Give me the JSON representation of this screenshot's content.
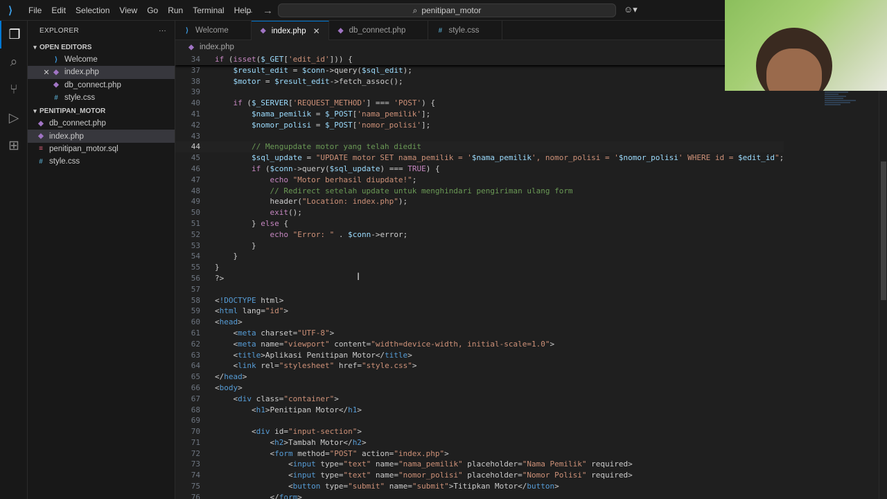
{
  "titlebar": {
    "menu": [
      "File",
      "Edit",
      "Selection",
      "View",
      "Go",
      "Run",
      "Terminal",
      "Help"
    ],
    "search_text": "penitipan_motor"
  },
  "sidebar": {
    "title": "EXPLORER",
    "open_editors_label": "OPEN EDITORS",
    "open_editors": [
      {
        "name": "Welcome",
        "type": "vs"
      },
      {
        "name": "index.php",
        "type": "php"
      },
      {
        "name": "db_connect.php",
        "type": "php"
      },
      {
        "name": "style.css",
        "type": "css"
      }
    ],
    "project_label": "PENITIPAN_MOTOR",
    "project_files": [
      {
        "name": "db_connect.php",
        "type": "php"
      },
      {
        "name": "index.php",
        "type": "php"
      },
      {
        "name": "penitipan_motor.sql",
        "type": "sql"
      },
      {
        "name": "style.css",
        "type": "css"
      }
    ]
  },
  "tabs": [
    {
      "label": "Welcome",
      "type": "vs"
    },
    {
      "label": "index.php",
      "type": "php"
    },
    {
      "label": "db_connect.php",
      "type": "php"
    },
    {
      "label": "style.css",
      "type": "css"
    }
  ],
  "breadcrumb": "index.php",
  "editor": {
    "sticky_line": {
      "num": "34",
      "text": "if (isset($_GET['edit_id'])) {"
    },
    "lines": [
      {
        "num": "37",
        "text": "    $result_edit = $conn->query($sql_edit);"
      },
      {
        "num": "38",
        "text": "    $motor = $result_edit->fetch_assoc();"
      },
      {
        "num": "39",
        "text": ""
      },
      {
        "num": "40",
        "text": "    if ($_SERVER['REQUEST_METHOD'] === 'POST') {"
      },
      {
        "num": "41",
        "text": "        $nama_pemilik = $_POST['nama_pemilik'];"
      },
      {
        "num": "42",
        "text": "        $nomor_polisi = $_POST['nomor_polisi'];"
      },
      {
        "num": "43",
        "text": ""
      },
      {
        "num": "44",
        "text": "        // Mengupdate motor yang telah diedit"
      },
      {
        "num": "45",
        "text": "        $sql_update = \"UPDATE motor SET nama_pemilik = '$nama_pemilik', nomor_polisi = '$nomor_polisi' WHERE id = $edit_id\";"
      },
      {
        "num": "46",
        "text": "        if ($conn->query($sql_update) === TRUE) {"
      },
      {
        "num": "47",
        "text": "            echo \"Motor berhasil diupdate!\";"
      },
      {
        "num": "48",
        "text": "            // Redirect setelah update untuk menghindari pengiriman ulang form"
      },
      {
        "num": "49",
        "text": "            header(\"Location: index.php\");"
      },
      {
        "num": "50",
        "text": "            exit();"
      },
      {
        "num": "51",
        "text": "        } else {"
      },
      {
        "num": "52",
        "text": "            echo \"Error: \" . $conn->error;"
      },
      {
        "num": "53",
        "text": "        }"
      },
      {
        "num": "54",
        "text": "    }"
      },
      {
        "num": "55",
        "text": "}"
      },
      {
        "num": "56",
        "text": "?>"
      },
      {
        "num": "57",
        "text": ""
      },
      {
        "num": "58",
        "text": "<!DOCTYPE html>"
      },
      {
        "num": "59",
        "text": "<html lang=\"id\">"
      },
      {
        "num": "60",
        "text": "<head>"
      },
      {
        "num": "61",
        "text": "    <meta charset=\"UTF-8\">"
      },
      {
        "num": "62",
        "text": "    <meta name=\"viewport\" content=\"width=device-width, initial-scale=1.0\">"
      },
      {
        "num": "63",
        "text": "    <title>Aplikasi Penitipan Motor</title>"
      },
      {
        "num": "64",
        "text": "    <link rel=\"stylesheet\" href=\"style.css\">"
      },
      {
        "num": "65",
        "text": "</head>"
      },
      {
        "num": "66",
        "text": "<body>"
      },
      {
        "num": "67",
        "text": "    <div class=\"container\">"
      },
      {
        "num": "68",
        "text": "        <h1>Penitipan Motor</h1>"
      },
      {
        "num": "69",
        "text": ""
      },
      {
        "num": "70",
        "text": "        <div id=\"input-section\">"
      },
      {
        "num": "71",
        "text": "            <h2>Tambah Motor</h2>"
      },
      {
        "num": "72",
        "text": "            <form method=\"POST\" action=\"index.php\">"
      },
      {
        "num": "73",
        "text": "                <input type=\"text\" name=\"nama_pemilik\" placeholder=\"Nama Pemilik\" required>"
      },
      {
        "num": "74",
        "text": "                <input type=\"text\" name=\"nomor_polisi\" placeholder=\"Nomor Polisi\" required>"
      },
      {
        "num": "75",
        "text": "                <button type=\"submit\" name=\"submit\">Titipkan Motor</button>"
      },
      {
        "num": "76",
        "text": "            </form>"
      }
    ]
  }
}
